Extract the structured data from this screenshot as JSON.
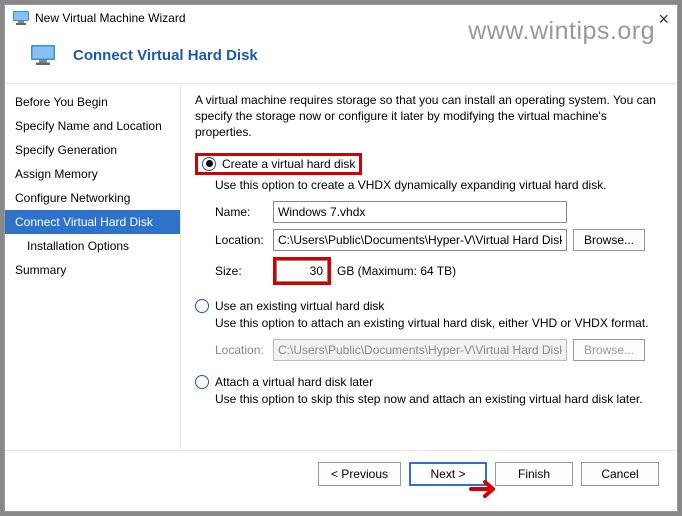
{
  "watermark": "www.wintips.org",
  "window": {
    "title": "New Virtual Machine Wizard"
  },
  "header": {
    "title": "Connect Virtual Hard Disk"
  },
  "sidebar": {
    "items": [
      {
        "label": "Before You Begin"
      },
      {
        "label": "Specify Name and Location"
      },
      {
        "label": "Specify Generation"
      },
      {
        "label": "Assign Memory"
      },
      {
        "label": "Configure Networking"
      },
      {
        "label": "Connect Virtual Hard Disk"
      },
      {
        "label": "Installation Options"
      },
      {
        "label": "Summary"
      }
    ]
  },
  "main": {
    "intro": "A virtual machine requires storage so that you can install an operating system. You can specify the storage now or configure it later by modifying the virtual machine's properties.",
    "opt1": {
      "label": "Create a virtual hard disk",
      "desc": "Use this option to create a VHDX dynamically expanding virtual hard disk.",
      "name_label": "Name:",
      "name_value": "Windows 7.vhdx",
      "loc_label": "Location:",
      "loc_value": "C:\\Users\\Public\\Documents\\Hyper-V\\Virtual Hard Disks\\",
      "browse": "Browse...",
      "size_label": "Size:",
      "size_value": "30",
      "size_suffix": "GB (Maximum: 64 TB)"
    },
    "opt2": {
      "label": "Use an existing virtual hard disk",
      "desc": "Use this option to attach an existing virtual hard disk, either VHD or VHDX format.",
      "loc_label": "Location:",
      "loc_value": "C:\\Users\\Public\\Documents\\Hyper-V\\Virtual Hard Disks\\",
      "browse": "Browse..."
    },
    "opt3": {
      "label": "Attach a virtual hard disk later",
      "desc": "Use this option to skip this step now and attach an existing virtual hard disk later."
    }
  },
  "footer": {
    "prev": "< Previous",
    "next": "Next >",
    "finish": "Finish",
    "cancel": "Cancel"
  }
}
